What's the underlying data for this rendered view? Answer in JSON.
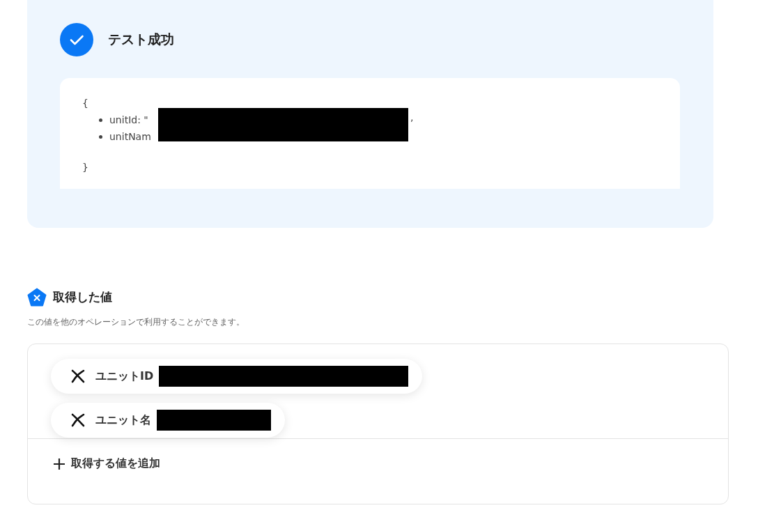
{
  "status": {
    "title": "テスト成功"
  },
  "output": {
    "lines": [
      {
        "kind": "brace",
        "text": "{"
      },
      {
        "kind": "item",
        "text": "unitId: \"",
        "suffix": ","
      },
      {
        "kind": "item",
        "text": "unitNam"
      },
      {
        "kind": "brace",
        "text": "}"
      }
    ]
  },
  "extracted": {
    "title": "取得した値",
    "description": "この値を他のオペレーションで利用することができます。",
    "values": [
      {
        "label": "ユニットID"
      },
      {
        "label": "ユニット名"
      }
    ],
    "add_button": "取得する値を追加"
  }
}
